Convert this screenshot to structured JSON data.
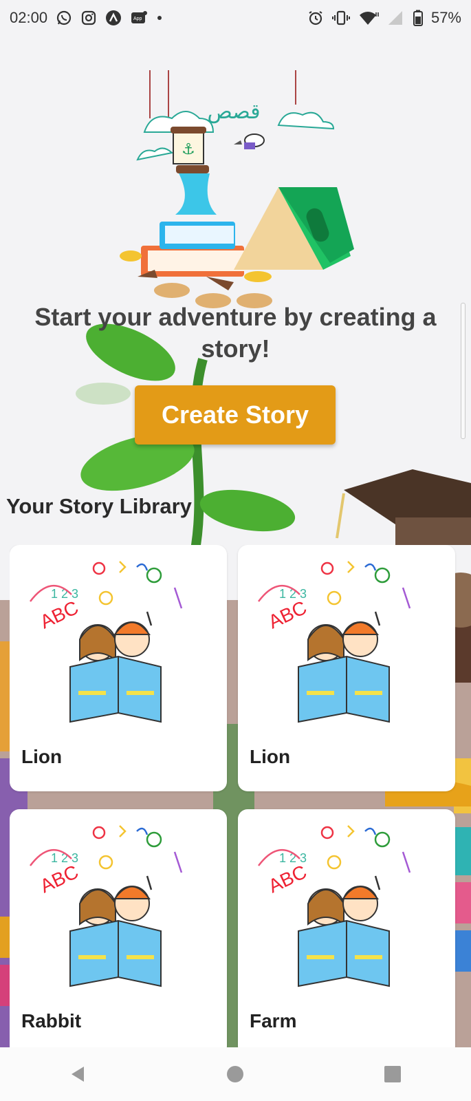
{
  "status_bar": {
    "time": "02:00",
    "battery_percent": "57%",
    "left_icons": [
      "whatsapp-icon",
      "instagram-icon",
      "app-a-icon",
      "app-badge-icon",
      "dot-icon"
    ],
    "right_icons": [
      "alarm-icon",
      "vibrate-icon",
      "wifi-icon",
      "signal-icon",
      "battery-icon"
    ]
  },
  "hero": {
    "arabic_title": "قصص"
  },
  "main": {
    "tagline": "Start your adventure by creating a story!",
    "create_button_label": "Create Story",
    "library_title": "Your Story Library"
  },
  "stories": [
    {
      "title": "Lion"
    },
    {
      "title": "Lion"
    },
    {
      "title": "Rabbit"
    },
    {
      "title": "Farm"
    }
  ],
  "colors": {
    "accent": "#e39b17",
    "background": "#f3f3f5",
    "card": "#ffffff",
    "text": "#444444"
  },
  "nav_bar": {
    "icons": [
      "back-icon",
      "home-icon",
      "recents-icon"
    ]
  }
}
